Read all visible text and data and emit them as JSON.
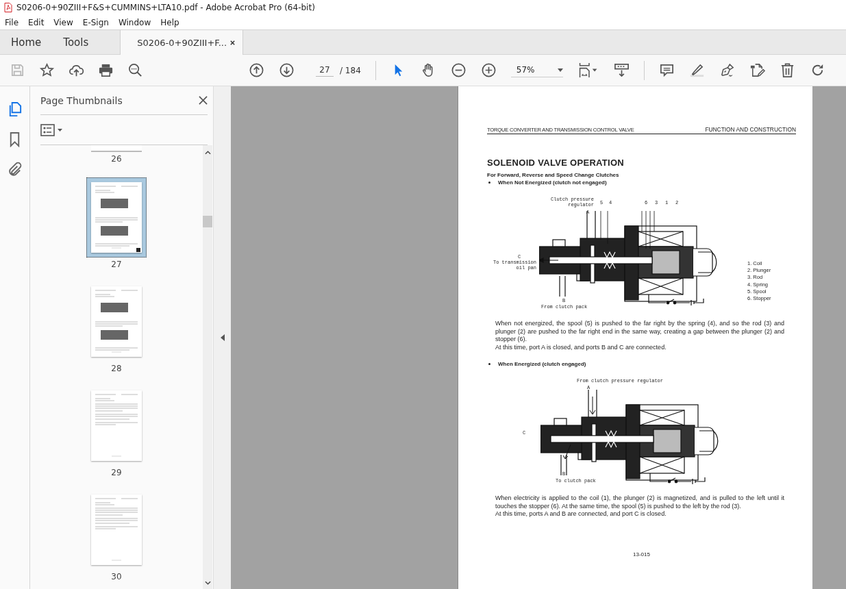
{
  "window": {
    "title": "S0206-0+90ZIII+F&S+CUMMINS+LTA10.pdf - Adobe Acrobat Pro (64-bit)"
  },
  "menu": [
    "File",
    "Edit",
    "View",
    "E-Sign",
    "Window",
    "Help"
  ],
  "tabs": [
    {
      "label": "Home",
      "kind": "nav",
      "selected": false
    },
    {
      "label": "Tools",
      "kind": "nav",
      "selected": false
    },
    {
      "label": "S0206-0+90ZIII+F...",
      "kind": "document",
      "selected": true
    }
  ],
  "toolbar": {
    "save_disabled": true,
    "page_current": "27",
    "page_total": "/ 184",
    "zoom": "57%",
    "select_tools": [
      {
        "kind": "pointer",
        "selected": true
      },
      {
        "kind": "hand",
        "selected": false
      }
    ]
  },
  "rail": [
    {
      "kind": "pages",
      "selected": true
    },
    {
      "kind": "bookmarks",
      "selected": false
    },
    {
      "kind": "attachments",
      "selected": false
    }
  ],
  "sidebar": {
    "title": "Page Thumbnails",
    "thumbnails": [
      {
        "label": "26",
        "kind": "partial",
        "selected": false
      },
      {
        "label": "27",
        "kind": "diagram",
        "selected": true
      },
      {
        "label": "28",
        "kind": "diagram",
        "selected": false
      },
      {
        "label": "29",
        "kind": "text",
        "selected": false
      },
      {
        "label": "30",
        "kind": "text",
        "selected": false
      }
    ]
  },
  "document": {
    "header_left": "TORQUE CONVERTER AND TRANSMISSION CONTROL VALVE",
    "header_right": "FUNCTION AND CONSTRUCTION",
    "title": "SOLENOID VALVE OPERATION",
    "subtitle": "For Forward, Reverse and Speed Change Clutches",
    "sections": [
      {
        "bullet": "When Not Energized (clutch not engaged)",
        "figure": {
          "kind": "not_energized",
          "labels": [
            "Clutch pressure regulator",
            "5",
            "4",
            "6",
            "3",
            "1",
            "2",
            "A",
            "C",
            "To transmission oil pan",
            "B",
            "From clutch pack"
          ],
          "legend": [
            "1. Coil",
            "2. Plunger",
            "3. Rod",
            "4. Spring",
            "5. Spool",
            "6. Stopper"
          ]
        },
        "paragraphs": [
          "When not energized, the spool (5) is pushed to the far right by the spring (4), and so the rod (3) and plunger (2) are pushed to the far right end in the same way, creating a gap between the plunger (2) and stopper (6).",
          "At this time, port A is closed, and ports B and C are connected."
        ]
      },
      {
        "bullet": "When Energized (clutch engaged)",
        "figure": {
          "kind": "energized",
          "labels": [
            "From clutch pressure regulator",
            "A",
            "C",
            "B",
            "To clutch pack"
          ]
        },
        "paragraphs": [
          "When electricity is applied to the coil (1), the plunger (2) is magnetized, and is pulled to the left until it touches the stopper (6).  At the same time, the spool (5) is pushed to the left by the rod (3).",
          "At this time, ports A and B are connected, and port C is closed."
        ]
      }
    ],
    "page_number": "13-015"
  }
}
